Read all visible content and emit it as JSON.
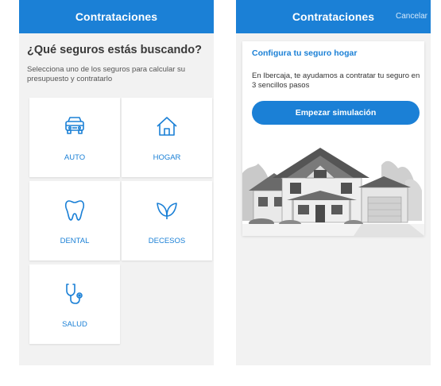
{
  "left_screen": {
    "header_title": "Contrataciones",
    "question": "¿Qué seguros estás buscando?",
    "subtitle": "Selecciona uno de los seguros para calcular su presupuesto y contratarlo",
    "tiles": [
      {
        "label": "AUTO",
        "icon": "car-icon"
      },
      {
        "label": "HOGAR",
        "icon": "house-icon"
      },
      {
        "label": "DENTAL",
        "icon": "tooth-icon"
      },
      {
        "label": "DECESOS",
        "icon": "leaves-icon"
      },
      {
        "label": "SALUD",
        "icon": "stethoscope-icon"
      }
    ]
  },
  "right_screen": {
    "header_title": "Contrataciones",
    "cancel_label": "Cancelar",
    "card_title": "Configura tu seguro hogar",
    "card_text": "En Ibercaja, te ayudamos a contratar tu seguro en 3 sencillos pasos",
    "cta_label": "Empezar simulación",
    "illustration": "house-illustration"
  },
  "colors": {
    "primary": "#1b80d6",
    "background": "#f2f2f2",
    "text_dark": "#3a3a3a"
  }
}
